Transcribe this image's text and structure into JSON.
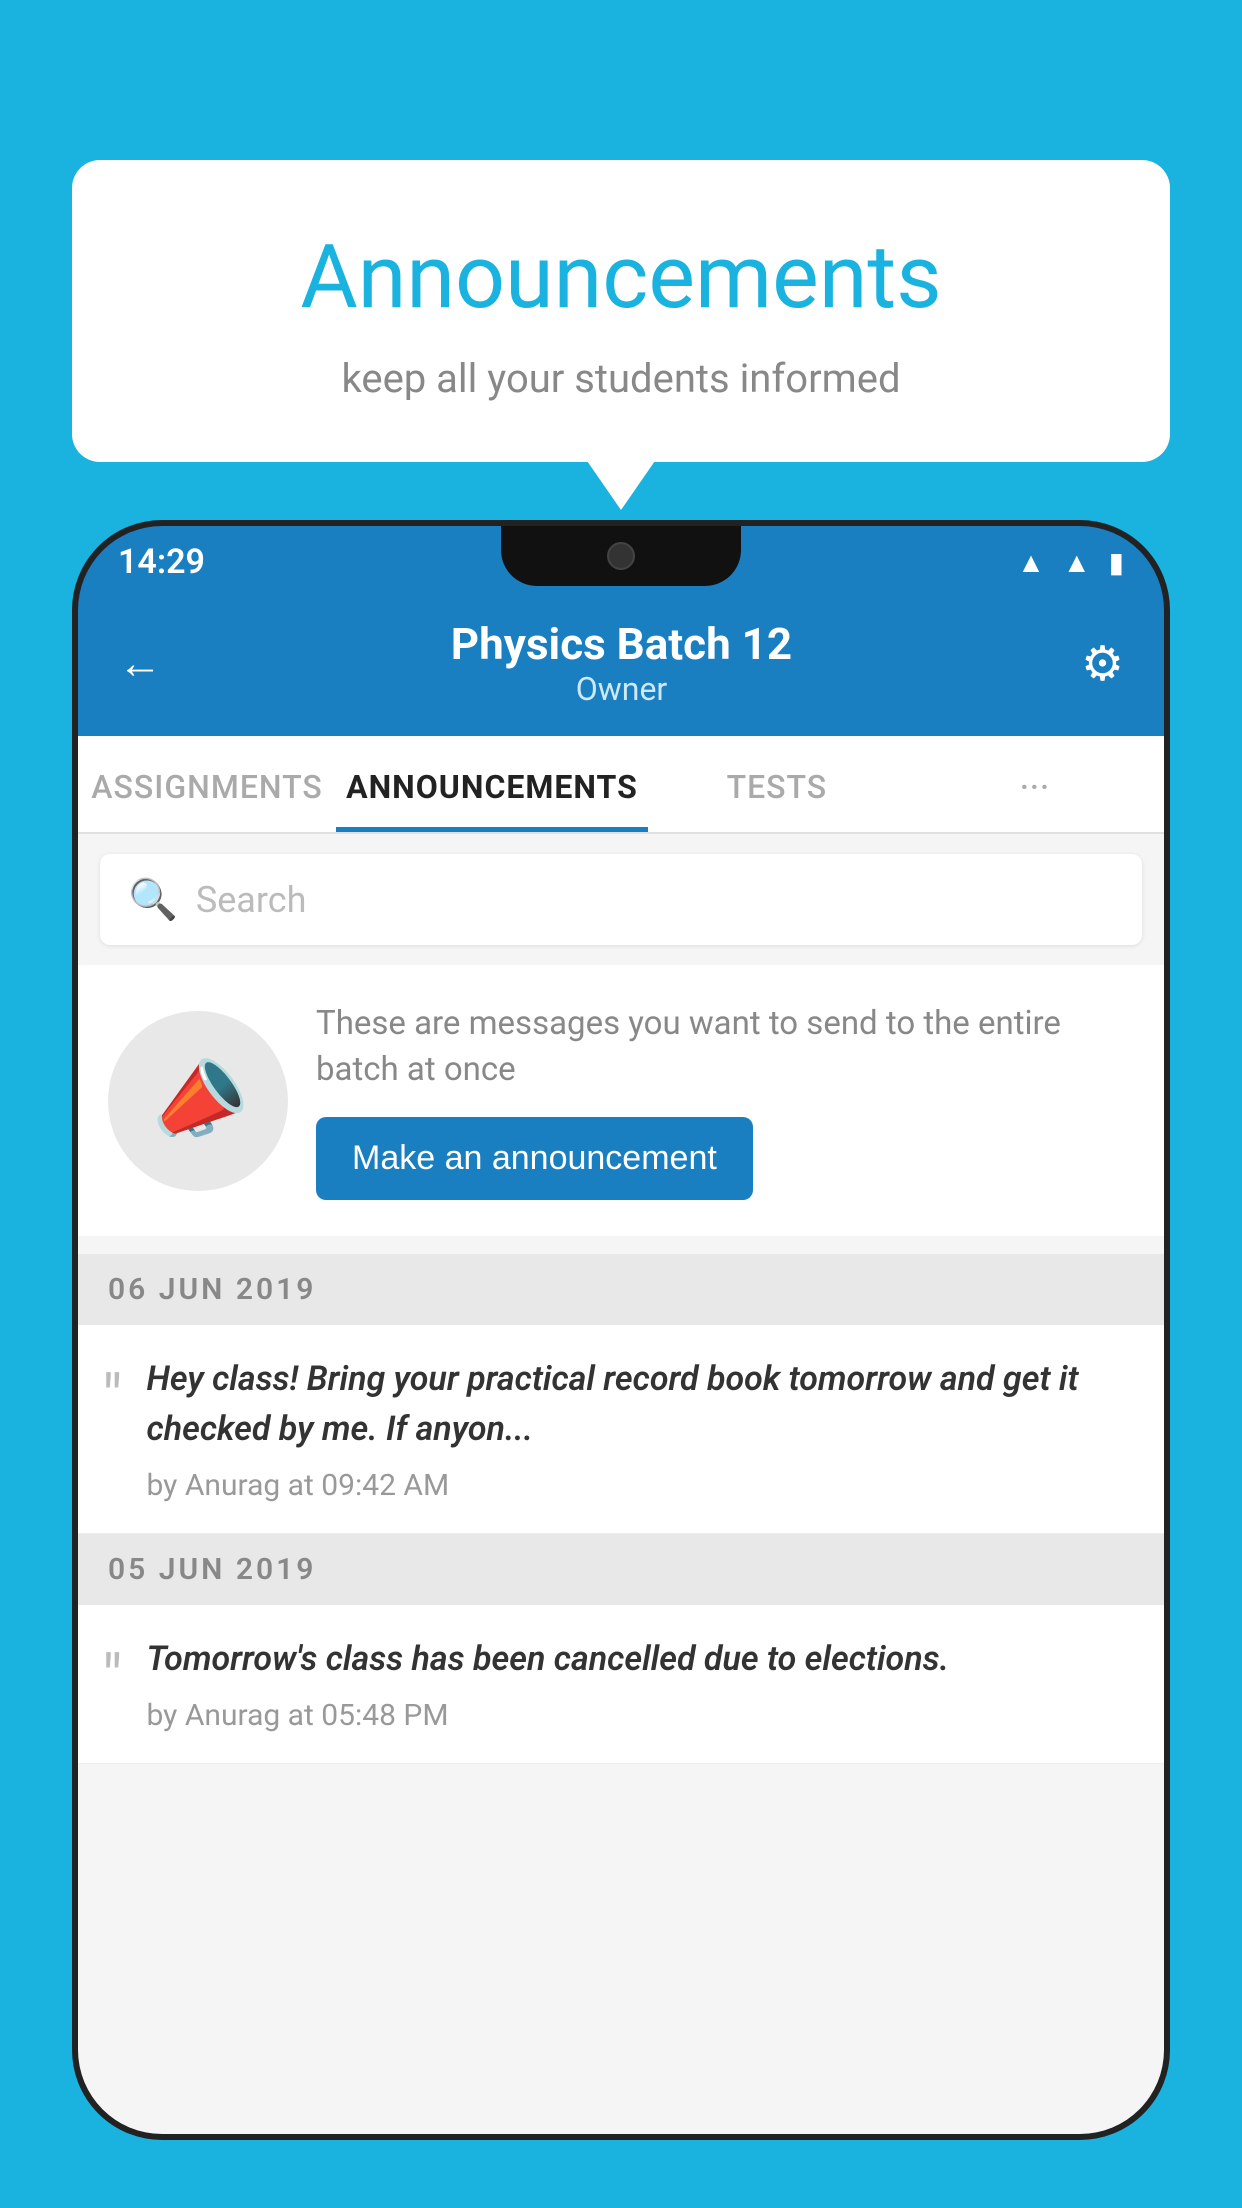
{
  "background_color": "#1ab3e0",
  "speech_bubble": {
    "title": "Announcements",
    "subtitle": "keep all your students informed"
  },
  "phone": {
    "status_bar": {
      "time": "14:29",
      "icons": [
        "wifi",
        "signal",
        "battery"
      ]
    },
    "header": {
      "back_label": "←",
      "title": "Physics Batch 12",
      "subtitle": "Owner",
      "gear_label": "⚙"
    },
    "tabs": [
      {
        "label": "ASSIGNMENTS",
        "active": false
      },
      {
        "label": "ANNOUNCEMENTS",
        "active": true
      },
      {
        "label": "TESTS",
        "active": false
      },
      {
        "label": "···",
        "active": false
      }
    ],
    "search": {
      "placeholder": "Search"
    },
    "promo": {
      "description": "These are messages you want to send to the entire batch at once",
      "button_label": "Make an announcement"
    },
    "announcements": [
      {
        "date": "06  JUN  2019",
        "text": "Hey class! Bring your practical record book tomorrow and get it checked by me. If anyon...",
        "meta": "by Anurag at 09:42 AM"
      },
      {
        "date": "05  JUN  2019",
        "text": "Tomorrow's class has been cancelled due to elections.",
        "meta": "by Anurag at 05:48 PM"
      }
    ]
  }
}
